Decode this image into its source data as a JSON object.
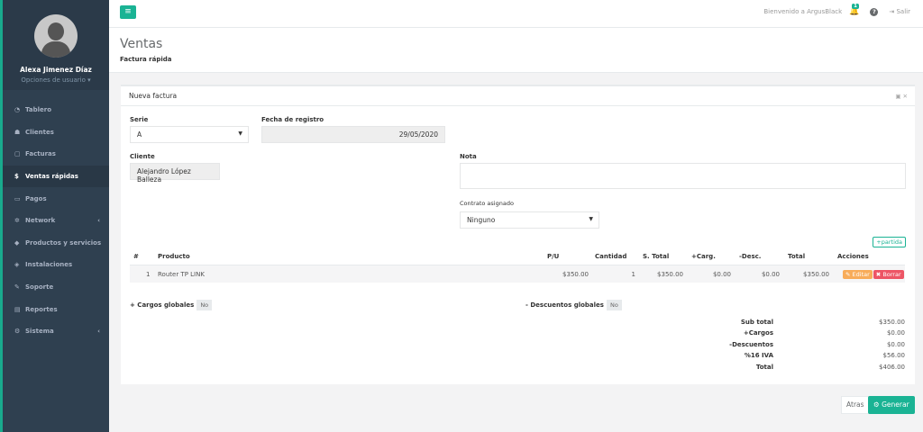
{
  "sidebar": {
    "user_name": "Alexa Jimenez Díaz",
    "user_options": "Opciones de usuario ▾",
    "items": [
      {
        "icon": "dashboard-icon",
        "glyph": "◔",
        "label": "Tablero"
      },
      {
        "icon": "users-icon",
        "glyph": "👥",
        "label": "Clientes"
      },
      {
        "icon": "file-icon",
        "glyph": "▢",
        "label": "Facturas"
      },
      {
        "icon": "dollar-icon",
        "glyph": "$",
        "label": "Ventas rápidas",
        "active": true
      },
      {
        "icon": "money-icon",
        "glyph": "▭",
        "label": "Pagos"
      },
      {
        "icon": "network-icon",
        "glyph": "✲",
        "label": "Network",
        "chevron": true
      },
      {
        "icon": "tag-icon",
        "glyph": "◆",
        "label": "Productos y servicios"
      },
      {
        "icon": "install-icon",
        "glyph": "◈",
        "label": "Instalaciones"
      },
      {
        "icon": "wrench-icon",
        "glyph": "✎",
        "label": "Soporte"
      },
      {
        "icon": "report-icon",
        "glyph": "▤",
        "label": "Reportes"
      },
      {
        "icon": "cogs-icon",
        "glyph": "⚙",
        "label": "Sistema",
        "chevron": true
      }
    ]
  },
  "topbar": {
    "welcome": "Bienvenido a ArgusBlack",
    "notif_count": "1",
    "logout": "Salir"
  },
  "heading": {
    "title": "Ventas",
    "breadcrumb": "Factura rápida"
  },
  "form": {
    "card_title": "Nueva factura",
    "serie_label": "Serie",
    "serie_value": "A",
    "fecha_label": "Fecha de registro",
    "fecha_value": "29/05/2020",
    "cliente_label": "Cliente",
    "cliente_value": "Alejandro López Balleza",
    "nota_label": "Nota",
    "contrato_label": "Contrato asignado",
    "contrato_value": "Ninguno",
    "add_partida": "partida"
  },
  "table": {
    "headers": {
      "num": "#",
      "producto": "Producto",
      "pu": "P/U",
      "cantidad": "Cantidad",
      "stotal": "S. Total",
      "carg": "+Carg.",
      "desc": "-Desc.",
      "total": "Total",
      "acciones": "Acciones"
    },
    "rows": [
      {
        "num": "1",
        "producto": "Router TP LINK",
        "pu": "$350.00",
        "cantidad": "1",
        "stotal": "$350.00",
        "carg": "$0.00",
        "desc": "$0.00",
        "total": "$350.00"
      }
    ],
    "edit_label": "Editar",
    "delete_label": "Borrar"
  },
  "globals": {
    "cargos_label": "+ Cargos globales",
    "cargos_value": "No",
    "descuentos_label": "- Descuentos globales",
    "descuentos_value": "No"
  },
  "totals": [
    {
      "label": "Sub total",
      "value": "$350.00"
    },
    {
      "label": "+Cargos",
      "value": "$0.00"
    },
    {
      "label": "-Descuentos",
      "value": "$0.00"
    },
    {
      "label": "%16 IVA",
      "value": "$56.00"
    },
    {
      "label": "Total",
      "value": "$406.00"
    }
  ],
  "actions": {
    "back": "Atras",
    "generate": "Generar"
  },
  "colors": {
    "accent": "#1ab394",
    "sidebar": "#2f4050",
    "edit": "#f8ac59",
    "delete": "#ed5565"
  }
}
